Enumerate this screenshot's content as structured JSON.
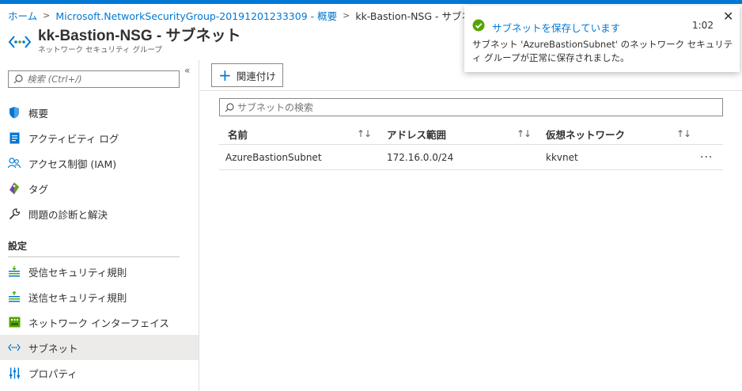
{
  "breadcrumb": {
    "home": "ホーム",
    "nsg": "Microsoft.NetworkSecurityGroup-20191201233309 - 概要",
    "current": "kk-Bastion-NSG - サブネット"
  },
  "header": {
    "title": "kk-Bastion-NSG - サブネット",
    "subtitle": "ネットワーク セキュリティ グループ"
  },
  "sidebar": {
    "search_placeholder": "検索 (Ctrl+/)",
    "items": [
      {
        "label": "概要",
        "icon": "shield-icon"
      },
      {
        "label": "アクティビティ ログ",
        "icon": "activity-log-icon"
      },
      {
        "label": "アクセス制御 (IAM)",
        "icon": "people-icon"
      },
      {
        "label": "タグ",
        "icon": "tag-icon"
      },
      {
        "label": "問題の診断と解決",
        "icon": "wrench-icon"
      }
    ],
    "section_label": "設定",
    "settings_items": [
      {
        "label": "受信セキュリティ規則",
        "icon": "inbound-rules-icon"
      },
      {
        "label": "送信セキュリティ規則",
        "icon": "outbound-rules-icon"
      },
      {
        "label": "ネットワーク インターフェイス",
        "icon": "network-interface-icon"
      },
      {
        "label": "サブネット",
        "icon": "subnet-icon",
        "active": true
      },
      {
        "label": "プロパティ",
        "icon": "properties-icon"
      }
    ]
  },
  "toolbar": {
    "associate_label": "関連付け"
  },
  "filter": {
    "placeholder": "サブネットの検索"
  },
  "table": {
    "columns": [
      "名前",
      "アドレス範囲",
      "仮想ネットワーク"
    ],
    "sort_glyph": "↑↓",
    "rows": [
      {
        "name": "AzureBastionSubnet",
        "address": "172.16.0.0/24",
        "vnet": "kkvnet"
      }
    ],
    "more_glyph": "···"
  },
  "toast": {
    "title": "サブネットを保存しています",
    "time": "1:02",
    "message": "サブネット 'AzureBastionSubnet' のネットワーク セキュリティ グループが正常に保存されました。",
    "close_glyph": "✕",
    "status_color": "#57a300"
  },
  "colors": {
    "accent": "#0078d4",
    "active_bg": "#edebe9"
  }
}
